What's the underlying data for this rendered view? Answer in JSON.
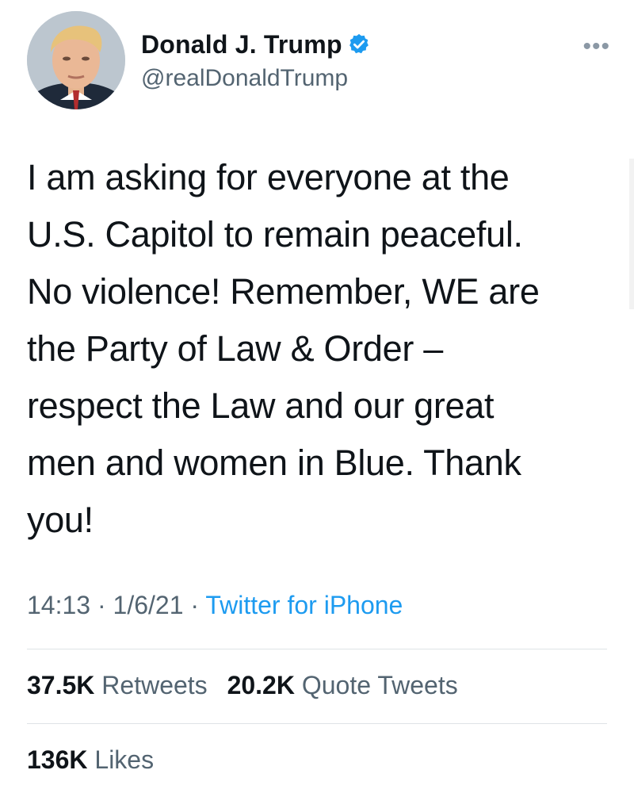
{
  "user": {
    "display_name": "Donald J. Trump",
    "handle": "@realDonaldTrump",
    "verified_icon": "verified-badge-icon",
    "avatar_icon": "avatar-photo"
  },
  "menu": {
    "more_label": "•••"
  },
  "tweet": {
    "lines": [
      "I am asking for everyone at the",
      "U.S. Capitol to remain peaceful.",
      "No violence! Remember, WE are",
      "the Party of Law & Order –",
      "respect the Law and our great",
      "men and women in Blue. Thank",
      "you!"
    ]
  },
  "meta": {
    "time": "14:13",
    "sep1": " · ",
    "date": "1/6/21",
    "sep2": " · ",
    "source": "Twitter for iPhone"
  },
  "stats": {
    "retweets_count": "37.5K",
    "retweets_label": "Retweets",
    "quotes_count": "20.2K",
    "quotes_label": "Quote Tweets",
    "likes_count": "136K",
    "likes_label": "Likes"
  },
  "colors": {
    "text": "#0f1419",
    "secondary": "#536471",
    "link": "#1d9bf0",
    "divider": "#dfe3e6"
  }
}
